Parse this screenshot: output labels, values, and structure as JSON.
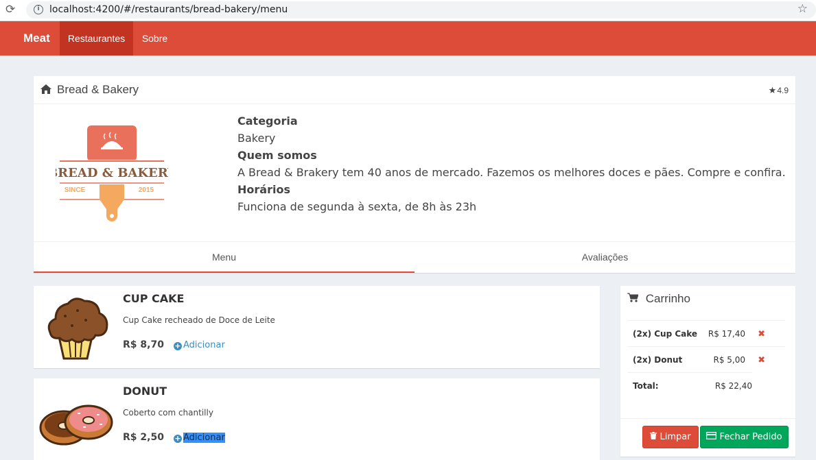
{
  "browser": {
    "url": "localhost:4200/#/restaurants/bread-bakery/menu"
  },
  "navbar": {
    "brand": "Meat",
    "items": [
      {
        "label": "Restaurantes",
        "active": true
      },
      {
        "label": "Sobre",
        "active": false
      }
    ],
    "color": "#dd4b39"
  },
  "restaurant": {
    "name": "Bread & Bakery",
    "rating": "4.9",
    "logo": {
      "title": "BREAD & BAKERY",
      "since": "SINCE",
      "year": "2015"
    },
    "category_label": "Categoria",
    "category": "Bakery",
    "about_label": "Quem somos",
    "about": "A Bread & Brakery tem 40 anos de mercado. Fazemos os melhores doces e pães. Compre e confira.",
    "hours_label": "Horários",
    "hours": "Funciona de segunda à sexta, de 8h às 23h"
  },
  "tabs": [
    {
      "label": "Menu",
      "active": true
    },
    {
      "label": "Avaliações",
      "active": false
    }
  ],
  "menu": [
    {
      "name": "CUP CAKE",
      "description": "Cup Cake recheado de Doce de Leite",
      "price": "R$ 8,70",
      "add_label": "Adicionar",
      "icon": "cupcake-image"
    },
    {
      "name": "DONUT",
      "description": "Coberto com chantilly",
      "price": "R$ 2,50",
      "add_label": "Adicionar",
      "icon": "donut-image"
    }
  ],
  "cart": {
    "title": "Carrinho",
    "items": [
      {
        "name": "(2x) Cup Cake",
        "price": "R$ 17,40"
      },
      {
        "name": "(2x) Donut",
        "price": "R$ 5,00"
      }
    ],
    "remove_symbol": "✖",
    "total_label": "Total:",
    "total": "R$ 22,40",
    "clear_label": "Limpar",
    "order_label": "Fechar Pedido"
  }
}
